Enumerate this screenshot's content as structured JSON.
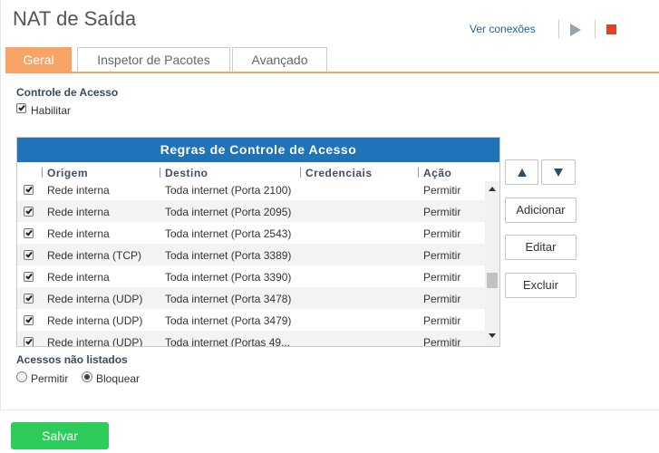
{
  "header": {
    "title": "NAT de Saída",
    "ver_conexoes": "Ver conexões",
    "play_icon": "play-icon",
    "stop_icon": "stop-icon",
    "stop_color": "#e8411e"
  },
  "tabs": [
    {
      "label": "Geral",
      "active": true
    },
    {
      "label": "Inspetor de Pacotes",
      "active": false
    },
    {
      "label": "Avançado",
      "active": false
    }
  ],
  "access_control": {
    "label": "Controle de Acesso",
    "enable_label": "Habilitar",
    "enabled": true
  },
  "grid": {
    "title": "Regras de Controle de Acesso",
    "columns": [
      "Origem",
      "Destino",
      "Credenciais",
      "Ação"
    ],
    "rows": [
      {
        "checked": true,
        "origem": "Rede interna",
        "destino": "Toda internet (Porta 2100)",
        "credenciais": "",
        "acao": "Permitir"
      },
      {
        "checked": true,
        "origem": "Rede interna",
        "destino": "Toda internet (Porta 2095)",
        "credenciais": "",
        "acao": "Permitir"
      },
      {
        "checked": true,
        "origem": "Rede interna",
        "destino": "Toda internet (Porta 2543)",
        "credenciais": "",
        "acao": "Permitir"
      },
      {
        "checked": true,
        "origem": "Rede interna (TCP)",
        "destino": "Toda internet (Porta 3389)",
        "credenciais": "",
        "acao": "Permitir"
      },
      {
        "checked": true,
        "origem": "Rede interna",
        "destino": "Toda internet (Porta 3390)",
        "credenciais": "",
        "acao": "Permitir"
      },
      {
        "checked": true,
        "origem": "Rede interna (UDP)",
        "destino": "Toda internet (Porta 3478)",
        "credenciais": "",
        "acao": "Permitir"
      },
      {
        "checked": true,
        "origem": "Rede interna (UDP)",
        "destino": "Toda internet (Porta 3479)",
        "credenciais": "",
        "acao": "Permitir"
      },
      {
        "checked": true,
        "origem": "Rede interna (UDP)",
        "destino": "Toda internet (Portas 49...",
        "credenciais": "",
        "acao": "Permitir"
      }
    ]
  },
  "side_buttons": {
    "up_icon": "arrow-up-icon",
    "down_icon": "arrow-down-icon",
    "add": "Adicionar",
    "edit": "Editar",
    "delete": "Excluir"
  },
  "unlisted": {
    "label": "Acessos não listados",
    "options": [
      "Permitir",
      "Bloquear"
    ],
    "selected": "Bloquear"
  },
  "footer": {
    "save": "Salvar",
    "save_color": "#2ecc5b"
  },
  "colors": {
    "accent": "#f8a466",
    "grid_header": "#1f73b7"
  }
}
